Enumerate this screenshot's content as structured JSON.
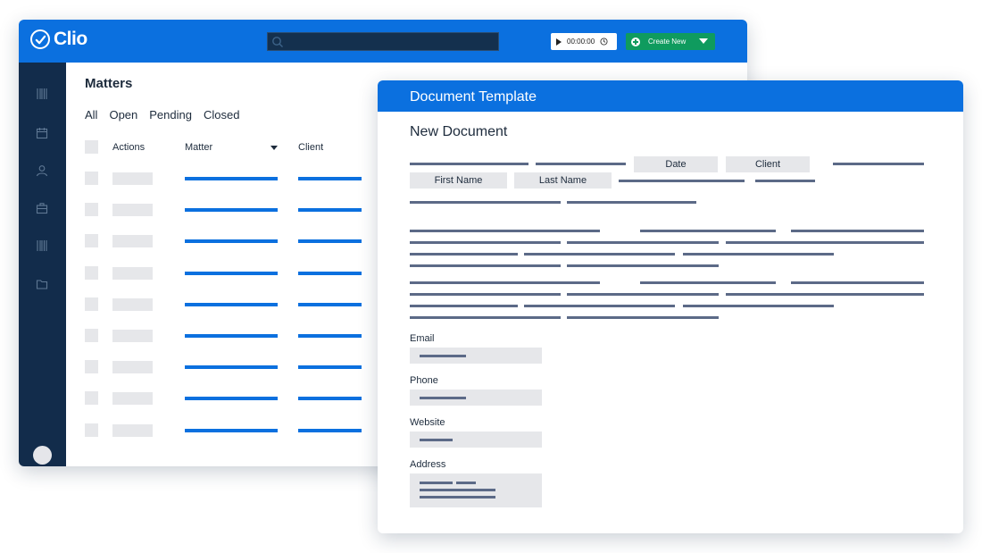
{
  "app": {
    "logo_text": "Clio",
    "search": {
      "placeholder": ""
    },
    "timer": {
      "time": "00:00:00"
    },
    "create_button": {
      "label": "Create New"
    },
    "sidebar_icons": [
      "barcode-icon",
      "calendar-icon",
      "user-icon",
      "briefcase-icon",
      "barcode-icon",
      "folder-icon"
    ],
    "colors": {
      "brand_blue": "#0b70df",
      "sidebar_navy": "#122c4b",
      "create_green": "#0f9b5e"
    }
  },
  "matters": {
    "title": "Matters",
    "filters": [
      "All",
      "Open",
      "Pending",
      "Closed"
    ],
    "columns": {
      "actions": "Actions",
      "matter": "Matter",
      "client": "Client"
    },
    "row_count": 9
  },
  "document": {
    "window_title": "Document Template",
    "heading": "New Document",
    "chips": {
      "date": "Date",
      "client": "Client",
      "first_name": "First Name",
      "last_name": "Last Name"
    },
    "fields": {
      "email": "Email",
      "phone": "Phone",
      "website": "Website",
      "address": "Address"
    }
  }
}
